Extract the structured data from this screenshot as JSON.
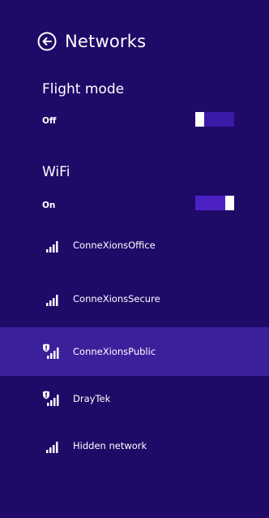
{
  "header": {
    "title": "Networks"
  },
  "flight_mode": {
    "label": "Flight mode",
    "state": "Off",
    "on": false
  },
  "wifi": {
    "label": "WiFi",
    "state": "On",
    "on": true
  },
  "networks": [
    {
      "name": "ConneXionsOffice",
      "secured": false,
      "selected": false
    },
    {
      "name": "ConneXionsSecure",
      "secured": false,
      "selected": false
    },
    {
      "name": "ConneXionsPublic",
      "secured": true,
      "selected": true
    },
    {
      "name": "DrayTek",
      "secured": true,
      "selected": false
    },
    {
      "name": "Hidden network",
      "secured": false,
      "selected": false
    }
  ],
  "colors": {
    "background": "#1f0a68",
    "selected_row": "#3b1f9b",
    "toggle_off_track": "#3a1aa6",
    "toggle_on_track": "#4b21c4",
    "text": "#ffffff"
  }
}
